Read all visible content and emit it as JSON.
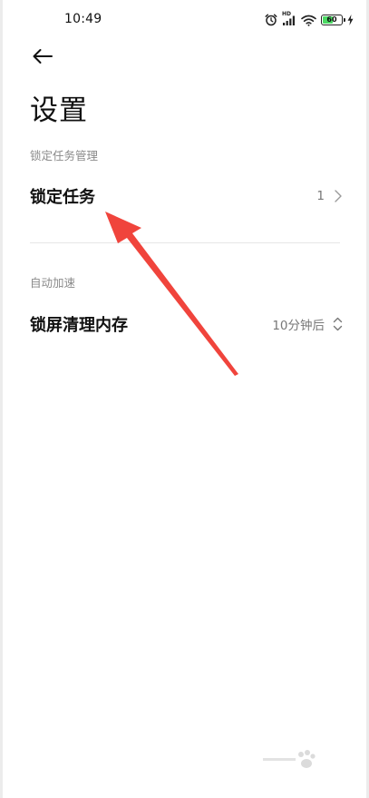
{
  "status_bar": {
    "time": "10:49",
    "battery_level": "60",
    "battery_fill": 0.6,
    "network_tag": "HD",
    "icons": [
      "alarm-icon",
      "signal-icon",
      "wifi-icon",
      "battery-icon",
      "charging-icon"
    ]
  },
  "header": {
    "back_icon": "arrow-left-icon",
    "title": "设置"
  },
  "sections": [
    {
      "header": "锁定任务管理",
      "rows": [
        {
          "label": "锁定任务",
          "value": "1",
          "icon": "chevron-right-icon"
        }
      ]
    },
    {
      "header": "自动加速",
      "rows": [
        {
          "label": "锁屏清理内存",
          "value": "10分钟后",
          "icon": "chevron-up-down-icon"
        }
      ]
    }
  ],
  "colors": {
    "annotation_arrow": "#f0443c",
    "battery_fill": "#4cd964",
    "section_header": "#8a8a8a"
  }
}
